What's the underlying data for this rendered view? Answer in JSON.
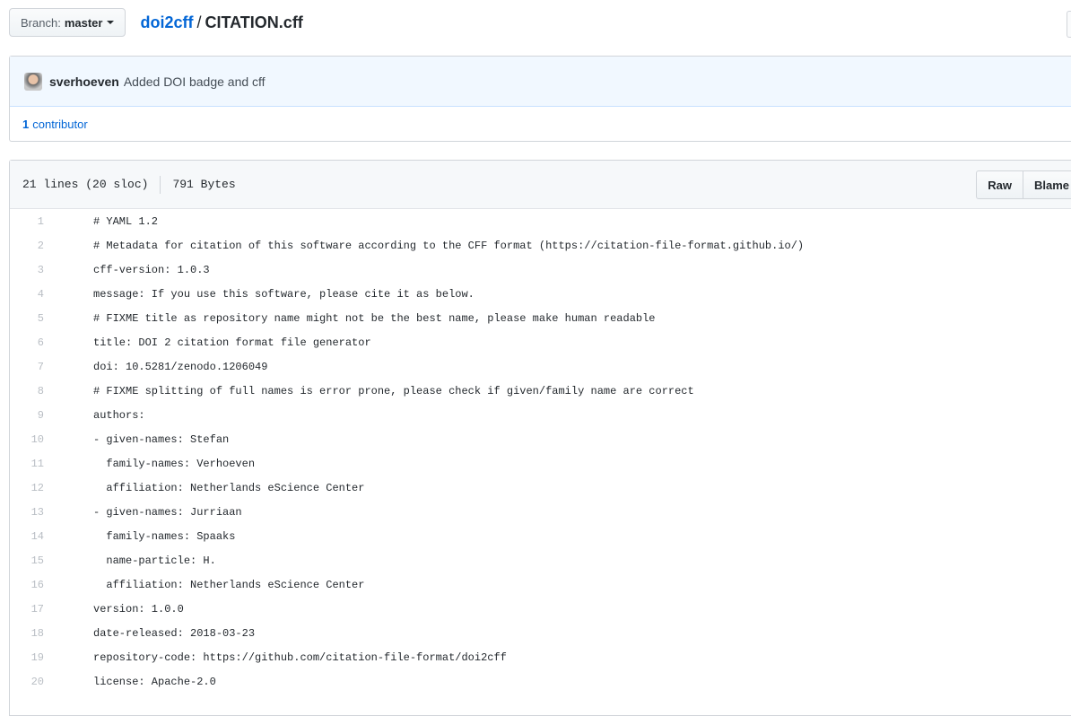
{
  "branch": {
    "label": "Branch:",
    "name": "master"
  },
  "breadcrumb": {
    "repo": "doi2cff",
    "separator": "/",
    "file": "CITATION.cff"
  },
  "commit": {
    "author": "sverhoeven",
    "message": "Added DOI badge and cff"
  },
  "contributors": {
    "count": "1",
    "label": "contributor"
  },
  "file_info": {
    "lines": "21 lines (20 sloc)",
    "size": "791 Bytes"
  },
  "buttons": {
    "raw": "Raw",
    "blame": "Blame"
  },
  "code_lines": [
    {
      "n": "1",
      "text": "# YAML 1.2"
    },
    {
      "n": "2",
      "text": "# Metadata for citation of this software according to the CFF format (https://citation-file-format.github.io/)"
    },
    {
      "n": "3",
      "text": "cff-version: 1.0.3"
    },
    {
      "n": "4",
      "text": "message: If you use this software, please cite it as below."
    },
    {
      "n": "5",
      "text": "# FIXME title as repository name might not be the best name, please make human readable"
    },
    {
      "n": "6",
      "text": "title: DOI 2 citation format file generator"
    },
    {
      "n": "7",
      "text": "doi: 10.5281/zenodo.1206049"
    },
    {
      "n": "8",
      "text": "# FIXME splitting of full names is error prone, please check if given/family name are correct"
    },
    {
      "n": "9",
      "text": "authors:"
    },
    {
      "n": "10",
      "text": "- given-names: Stefan"
    },
    {
      "n": "11",
      "text": "  family-names: Verhoeven"
    },
    {
      "n": "12",
      "text": "  affiliation: Netherlands eScience Center"
    },
    {
      "n": "13",
      "text": "- given-names: Jurriaan"
    },
    {
      "n": "14",
      "text": "  family-names: Spaaks"
    },
    {
      "n": "15",
      "text": "  name-particle: H."
    },
    {
      "n": "16",
      "text": "  affiliation: Netherlands eScience Center"
    },
    {
      "n": "17",
      "text": "version: 1.0.0"
    },
    {
      "n": "18",
      "text": "date-released: 2018-03-23"
    },
    {
      "n": "19",
      "text": "repository-code: https://github.com/citation-file-format/doi2cff"
    },
    {
      "n": "20",
      "text": "license: Apache-2.0"
    }
  ]
}
